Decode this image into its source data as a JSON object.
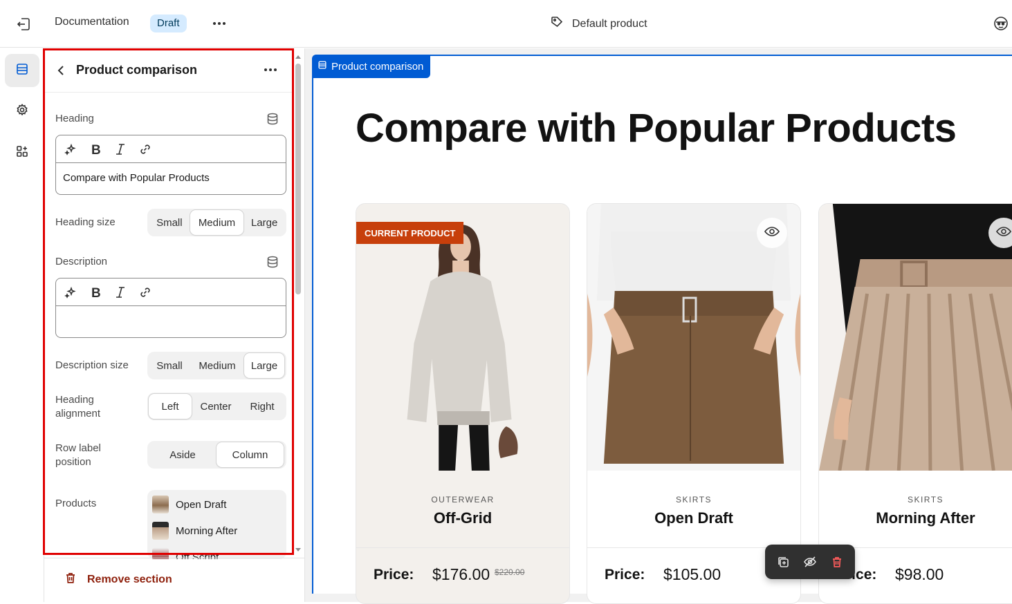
{
  "topbar": {
    "doc_title": "Documentation",
    "status_badge": "Draft",
    "template_name": "Default product"
  },
  "panel": {
    "title": "Product comparison",
    "heading": {
      "label": "Heading",
      "value": "Compare with Popular Products"
    },
    "heading_size": {
      "label": "Heading size",
      "options": [
        "Small",
        "Medium",
        "Large"
      ],
      "selected": "Medium"
    },
    "description": {
      "label": "Description",
      "value": ""
    },
    "description_size": {
      "label": "Description size",
      "options": [
        "Small",
        "Medium",
        "Large"
      ],
      "selected": "Large"
    },
    "heading_alignment": {
      "label": "Heading alignment",
      "options": [
        "Left",
        "Center",
        "Right"
      ],
      "selected": "Left"
    },
    "row_label_position": {
      "label": "Row label position",
      "options": [
        "Aside",
        "Column"
      ],
      "selected": "Column"
    },
    "products": {
      "label": "Products",
      "items": [
        "Open Draft",
        "Morning After",
        "Off Script"
      ]
    },
    "remove_label": "Remove section"
  },
  "preview": {
    "section_tag": "Product comparison",
    "heading": "Compare with Popular Products",
    "current_badge": "CURRENT PRODUCT",
    "price_label": "Price:",
    "cards": [
      {
        "category": "OUTERWEAR",
        "name": "Off-Grid",
        "price": "$176.00",
        "compare_price": "$220.00"
      },
      {
        "category": "SKIRTS",
        "name": "Open Draft",
        "price": "$105.00",
        "compare_price": ""
      },
      {
        "category": "SKIRTS",
        "name": "Morning After",
        "price": "$98.00",
        "compare_price": ""
      }
    ]
  },
  "colors": {
    "accent": "#005bd3",
    "highlight": "#e00000",
    "badge_current": "#c73f0b",
    "danger": "#8e1f0b"
  }
}
